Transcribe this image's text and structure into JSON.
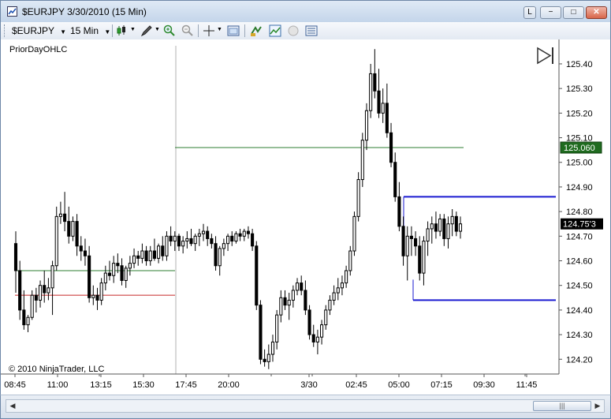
{
  "window": {
    "title": "$EURJPY  3/30/2010 (15 Min)",
    "buttons": [
      "L",
      "−",
      "□",
      "✕"
    ]
  },
  "toolbar": {
    "instrument": "$EURJPY",
    "interval": "15 Min"
  },
  "chart": {
    "indicator_label": "PriorDayOHLC",
    "copyright": "© 2010 NinjaTrader, LLC"
  },
  "chart_data": {
    "type": "candlestick",
    "instrument": "$EURJPY",
    "interval": "15 Min",
    "y_ticks": [
      "125.40",
      "125.30",
      "125.20",
      "125.10",
      "125.00",
      "124.90",
      "124.80",
      "124.70",
      "124.60",
      "124.50",
      "124.40",
      "124.30",
      "124.20"
    ],
    "x_ticks": [
      "08:45",
      "11:00",
      "13:15",
      "15:30",
      "17:45",
      "20:00",
      "3/30",
      "02:45",
      "05:00",
      "07:15",
      "09:30",
      "11:45"
    ],
    "ylim": [
      124.14,
      125.48
    ],
    "last_price_label": "124.75'3",
    "marker_label": "125.060",
    "colors": {
      "up_candle": "#ffffff",
      "down_candle": "#000000",
      "prior_high_line": "#2e7d32",
      "prior_low_line": "#c62828",
      "range_lines": "#1a1ad0",
      "marker_badge": "#1f6b1f"
    },
    "candles": [
      [
        124.67,
        124.72,
        124.47,
        124.56
      ],
      [
        124.56,
        124.6,
        124.36,
        124.4
      ],
      [
        124.4,
        124.48,
        124.32,
        124.34
      ],
      [
        124.34,
        124.38,
        124.31,
        124.37
      ],
      [
        124.37,
        124.48,
        124.36,
        124.46
      ],
      [
        124.46,
        124.49,
        124.39,
        124.44
      ],
      [
        124.44,
        124.52,
        124.41,
        124.5
      ],
      [
        124.5,
        124.56,
        124.43,
        124.47
      ],
      [
        124.47,
        124.53,
        124.44,
        124.49
      ],
      [
        124.49,
        124.6,
        124.38,
        124.58
      ],
      [
        124.58,
        124.82,
        124.56,
        124.78
      ],
      [
        124.78,
        124.84,
        124.75,
        124.79
      ],
      [
        124.79,
        124.88,
        124.72,
        124.76
      ],
      [
        124.76,
        124.82,
        124.67,
        124.7
      ],
      [
        124.7,
        124.78,
        124.68,
        124.76
      ],
      [
        124.76,
        124.79,
        124.62,
        124.66
      ],
      [
        124.66,
        124.7,
        124.6,
        124.64
      ],
      [
        124.64,
        124.69,
        124.58,
        124.62
      ],
      [
        124.62,
        124.66,
        124.43,
        124.45
      ],
      [
        124.45,
        124.5,
        124.42,
        124.46
      ],
      [
        124.46,
        124.49,
        124.4,
        124.44
      ],
      [
        124.44,
        124.53,
        124.42,
        124.51
      ],
      [
        124.51,
        124.58,
        124.48,
        124.55
      ],
      [
        124.55,
        124.6,
        124.52,
        124.54
      ],
      [
        124.54,
        124.62,
        124.51,
        124.59
      ],
      [
        124.59,
        124.63,
        124.55,
        124.58
      ],
      [
        124.58,
        124.61,
        124.5,
        124.52
      ],
      [
        124.52,
        124.58,
        124.49,
        124.57
      ],
      [
        124.57,
        124.62,
        124.54,
        124.59
      ],
      [
        124.59,
        124.65,
        124.57,
        124.62
      ],
      [
        124.62,
        124.64,
        124.58,
        124.61
      ],
      [
        124.61,
        124.67,
        124.59,
        124.64
      ],
      [
        124.64,
        124.66,
        124.58,
        124.6
      ],
      [
        124.6,
        124.66,
        124.58,
        124.64
      ],
      [
        124.64,
        124.69,
        124.6,
        124.61
      ],
      [
        124.61,
        124.67,
        124.59,
        124.66
      ],
      [
        124.66,
        124.7,
        124.6,
        124.62
      ],
      [
        124.62,
        124.72,
        124.6,
        124.7
      ],
      [
        124.7,
        124.74,
        124.66,
        124.68
      ],
      [
        124.68,
        124.72,
        124.64,
        124.7
      ],
      [
        124.7,
        124.71,
        124.64,
        124.66
      ],
      [
        124.66,
        124.7,
        124.63,
        124.68
      ],
      [
        124.68,
        124.72,
        124.65,
        124.69
      ],
      [
        124.69,
        124.73,
        124.66,
        124.67
      ],
      [
        124.67,
        124.71,
        124.64,
        124.7
      ],
      [
        124.7,
        124.73,
        124.66,
        124.71
      ],
      [
        124.71,
        124.75,
        124.68,
        124.72
      ],
      [
        124.72,
        124.74,
        124.66,
        124.69
      ],
      [
        124.69,
        124.71,
        124.65,
        124.67
      ],
      [
        124.67,
        124.7,
        124.56,
        124.58
      ],
      [
        124.58,
        124.66,
        124.54,
        124.65
      ],
      [
        124.65,
        124.69,
        124.62,
        124.67
      ],
      [
        124.67,
        124.71,
        124.64,
        124.7
      ],
      [
        124.7,
        124.72,
        124.66,
        124.68
      ],
      [
        124.68,
        124.72,
        124.67,
        124.71
      ],
      [
        124.71,
        124.73,
        124.68,
        124.7
      ],
      [
        124.7,
        124.73,
        124.68,
        124.72
      ],
      [
        124.72,
        124.74,
        124.69,
        124.71
      ],
      [
        124.71,
        124.73,
        124.64,
        124.66
      ],
      [
        124.66,
        124.68,
        124.4,
        124.42
      ],
      [
        124.42,
        124.44,
        124.18,
        124.2
      ],
      [
        124.2,
        124.24,
        124.17,
        124.19
      ],
      [
        124.19,
        124.26,
        124.16,
        124.22
      ],
      [
        124.22,
        124.3,
        124.19,
        124.27
      ],
      [
        124.27,
        124.4,
        124.24,
        124.38
      ],
      [
        124.38,
        124.48,
        124.35,
        124.45
      ],
      [
        124.45,
        124.48,
        124.4,
        124.42
      ],
      [
        124.42,
        124.47,
        124.36,
        124.44
      ],
      [
        124.44,
        124.5,
        124.41,
        124.48
      ],
      [
        124.48,
        124.53,
        124.46,
        124.51
      ],
      [
        124.51,
        124.54,
        124.46,
        124.48
      ],
      [
        124.48,
        124.52,
        124.38,
        124.4
      ],
      [
        124.4,
        124.42,
        124.28,
        124.3
      ],
      [
        124.3,
        124.34,
        124.25,
        124.27
      ],
      [
        124.27,
        124.32,
        124.22,
        124.29
      ],
      [
        124.29,
        124.36,
        124.26,
        124.34
      ],
      [
        124.34,
        124.42,
        124.32,
        124.4
      ],
      [
        124.4,
        124.46,
        124.38,
        124.44
      ],
      [
        124.44,
        124.5,
        124.42,
        124.47
      ],
      [
        124.47,
        124.53,
        124.44,
        124.49
      ],
      [
        124.49,
        124.54,
        124.46,
        124.51
      ],
      [
        124.51,
        124.58,
        124.49,
        124.56
      ],
      [
        124.56,
        124.66,
        124.54,
        124.64
      ],
      [
        124.64,
        124.8,
        124.62,
        124.78
      ],
      [
        124.78,
        124.96,
        124.76,
        124.93
      ],
      [
        124.93,
        125.12,
        124.9,
        125.09
      ],
      [
        125.09,
        125.24,
        125.05,
        125.21
      ],
      [
        125.21,
        125.4,
        125.18,
        125.36
      ],
      [
        125.36,
        125.46,
        125.26,
        125.29
      ],
      [
        125.29,
        125.38,
        125.18,
        125.2
      ],
      [
        125.2,
        125.3,
        125.16,
        125.24
      ],
      [
        125.24,
        125.32,
        125.1,
        125.12
      ],
      [
        125.12,
        125.16,
        124.98,
        125.0
      ],
      [
        125.0,
        125.04,
        124.84,
        124.86
      ],
      [
        124.86,
        124.92,
        124.72,
        124.74
      ],
      [
        124.74,
        124.78,
        124.58,
        124.62
      ],
      [
        124.62,
        124.74,
        124.52,
        124.7
      ],
      [
        124.7,
        124.74,
        124.62,
        124.69
      ],
      [
        124.69,
        124.72,
        124.62,
        124.66
      ],
      [
        124.66,
        124.7,
        124.52,
        124.55
      ],
      [
        124.55,
        124.7,
        124.5,
        124.68
      ],
      [
        124.68,
        124.76,
        124.62,
        124.73
      ],
      [
        124.73,
        124.78,
        124.67,
        124.75
      ],
      [
        124.75,
        124.8,
        124.69,
        124.72
      ],
      [
        124.72,
        124.79,
        124.7,
        124.77
      ],
      [
        124.77,
        124.79,
        124.66,
        124.69
      ],
      [
        124.69,
        124.78,
        124.65,
        124.75
      ],
      [
        124.75,
        124.81,
        124.7,
        124.78
      ],
      [
        124.78,
        124.8,
        124.7,
        124.72
      ],
      [
        124.72,
        124.78,
        124.69,
        124.75
      ]
    ],
    "prior_high_line_value": 124.56,
    "prior_low_line_value": 124.46,
    "marker_line_value": 125.06,
    "range_high_value": 124.86,
    "range_low_value": 124.44
  }
}
